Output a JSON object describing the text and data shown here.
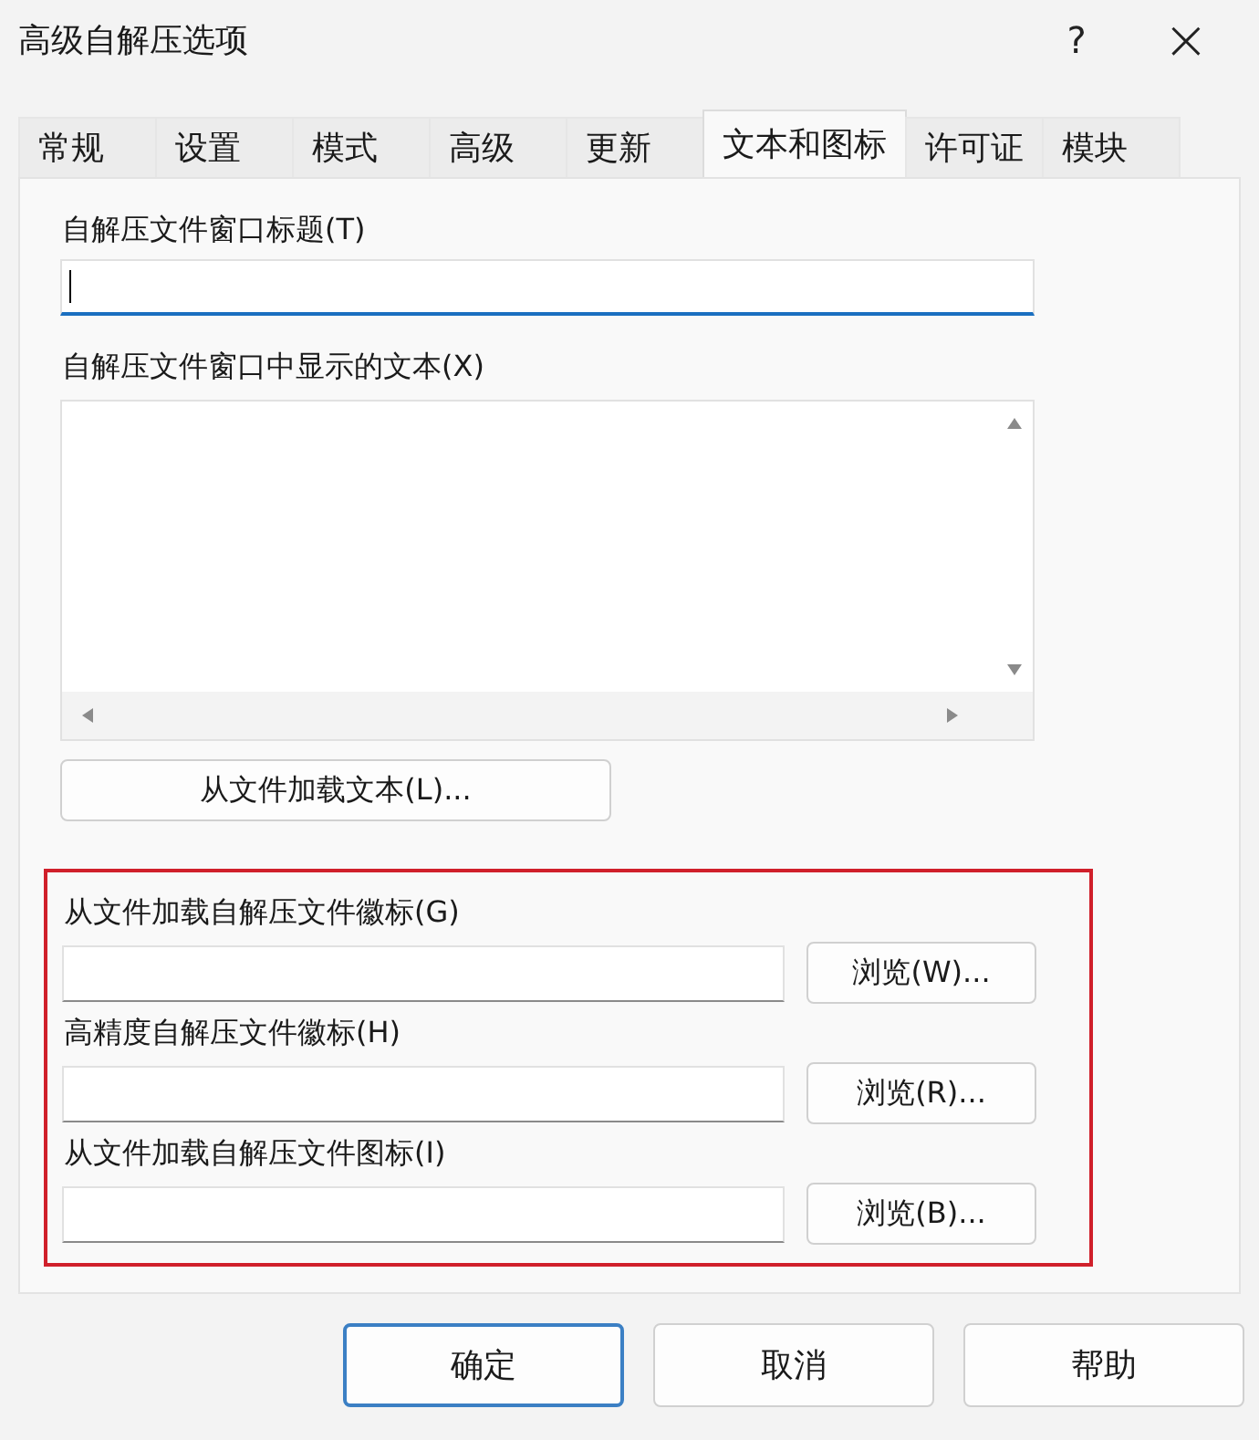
{
  "window": {
    "title": "高级自解压选项",
    "help": "?",
    "close": "×"
  },
  "tabs": [
    {
      "label": "常规",
      "selected": false
    },
    {
      "label": "设置",
      "selected": false
    },
    {
      "label": "模式",
      "selected": false
    },
    {
      "label": "高级",
      "selected": false
    },
    {
      "label": "更新",
      "selected": false
    },
    {
      "label": "文本和图标",
      "selected": true
    },
    {
      "label": "许可证",
      "selected": false
    },
    {
      "label": "模块",
      "selected": false
    }
  ],
  "title_field": {
    "label": "自解压文件窗口标题(T)",
    "focused": true
  },
  "text_area": {
    "label": "自解压文件窗口中显示的文本(X)"
  },
  "load_text_button": "从文件加载文本(L)...",
  "icon_section": {
    "highlighted": true,
    "rows": [
      {
        "label": "从文件加载自解压文件徽标(G)",
        "button": "浏览(W)..."
      },
      {
        "label": "高精度自解压文件徽标(H)",
        "button": "浏览(R)..."
      },
      {
        "label": "从文件加载自解压文件图标(I)",
        "button": "浏览(B)..."
      }
    ]
  },
  "buttons": [
    {
      "label": "确定",
      "default": true
    },
    {
      "label": "取消",
      "default": false
    },
    {
      "label": "帮助",
      "default": false
    }
  ]
}
